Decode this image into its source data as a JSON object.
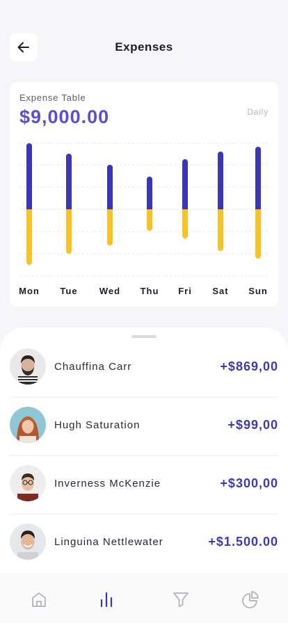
{
  "header": {
    "title": "Expenses"
  },
  "chart_card": {
    "label": "Expense Table",
    "total": "$9,000.00",
    "period": "Daily"
  },
  "chart_data": {
    "type": "bar",
    "categories": [
      "Mon",
      "Tue",
      "Wed",
      "Thu",
      "Fri",
      "Sat",
      "Sun"
    ],
    "series": [
      {
        "values": [
          95,
          80,
          64,
          47,
          72,
          83,
          90
        ]
      },
      {
        "values": [
          -80,
          -64,
          -52,
          -31,
          -42,
          -60,
          -71
        ]
      }
    ],
    "colors": [
      "#3b35b8",
      "#f7c325"
    ],
    "ylim": [
      -100,
      100
    ],
    "grid": true
  },
  "transactions": [
    {
      "name": "Chauffina Carr",
      "amount": "+$869,00",
      "avatar": "avatar-bearded-man"
    },
    {
      "name": "Hugh Saturation",
      "amount": "+$99,00",
      "avatar": "avatar-red-haired-woman"
    },
    {
      "name": "Inverness McKenzie",
      "amount": "+$300,00",
      "avatar": "avatar-man-glasses"
    },
    {
      "name": "Linguina Nettlewater",
      "amount": "+$1.500.00",
      "avatar": "avatar-smiling-man"
    }
  ],
  "nav": {
    "items": [
      "home-icon",
      "bar-chart-icon",
      "filter-icon",
      "pie-chart-icon"
    ],
    "active_color": "#3b35b8",
    "inactive_color": "#b9b9c2"
  }
}
